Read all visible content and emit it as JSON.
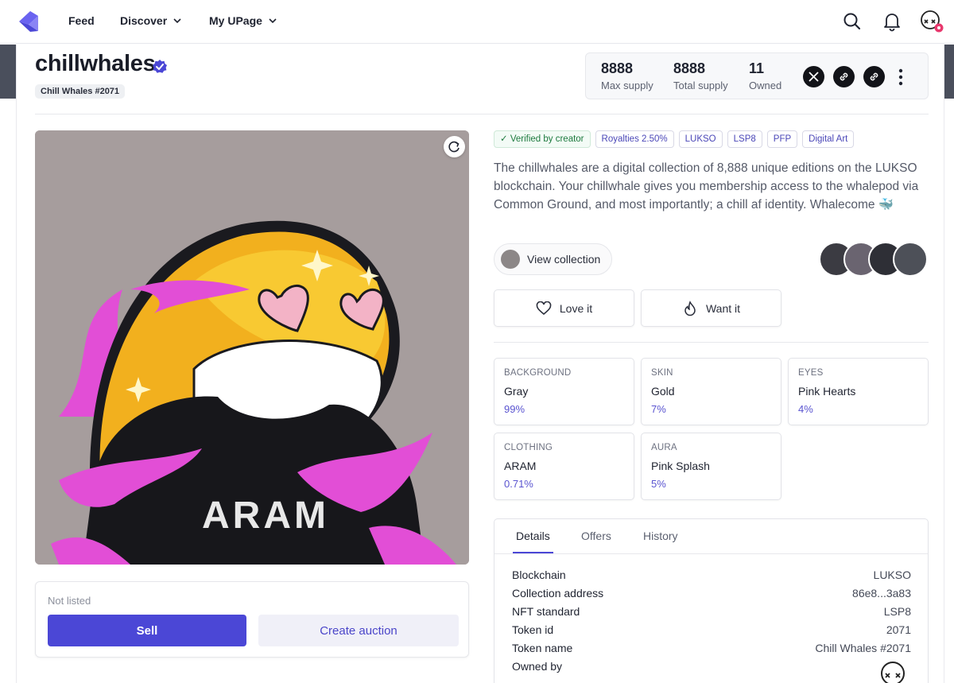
{
  "nav": {
    "feed": "Feed",
    "discover": "Discover",
    "my_upage": "My UPage",
    "icons": [
      "search-icon",
      "bell-icon",
      "profile-avatar"
    ]
  },
  "header": {
    "title": "chillwhales",
    "token_label": "Chill Whales #2071",
    "stats": [
      {
        "value": "8888",
        "label": "Max supply"
      },
      {
        "value": "8888",
        "label": "Total supply"
      },
      {
        "value": "11",
        "label": "Owned"
      }
    ],
    "social_icons": [
      "x-icon",
      "link-icon",
      "link-icon",
      "more-vertical-icon"
    ]
  },
  "sale": {
    "status": "Not listed",
    "sell_label": "Sell",
    "auction_label": "Create auction"
  },
  "tags": [
    "✓ Verified by creator",
    "Royalties 2.50%",
    "LUKSO",
    "LSP8",
    "PFP",
    "Digital Art"
  ],
  "description": "The chillwhales are a digital collection of 8,888 unique editions on the LUKSO blockchain. Your chillwhale gives you membership access to the whalepod via Common Ground, and most importantly; a chill af identity. Whalecome 🐳",
  "collection": {
    "button_label": "View collection"
  },
  "actions": {
    "love": "Love it",
    "want": "Want it"
  },
  "traits": [
    {
      "key": "BACKGROUND",
      "value": "Gray",
      "pct": "99%"
    },
    {
      "key": "SKIN",
      "value": "Gold",
      "pct": "7%"
    },
    {
      "key": "EYES",
      "value": "Pink Hearts",
      "pct": "4%"
    },
    {
      "key": "CLOTHING",
      "value": "ARAM",
      "pct": "0.71%"
    },
    {
      "key": "AURA",
      "value": "Pink Splash",
      "pct": "5%"
    }
  ],
  "details": {
    "tabs": [
      "Details",
      "Offers",
      "History"
    ],
    "active_tab": "Details",
    "rows": [
      {
        "key": "Blockchain",
        "value": "LUKSO"
      },
      {
        "key": "Collection address",
        "value": "86e8...3a83"
      },
      {
        "key": "NFT standard",
        "value": "LSP8"
      },
      {
        "key": "Token id",
        "value": "2071"
      },
      {
        "key": "Token name",
        "value": "Chill Whales #2071"
      },
      {
        "key": "Owned by",
        "value": ""
      }
    ]
  },
  "artwork": {
    "hoodie_text": "ARAM"
  },
  "colors": {
    "accent": "#4b47d6",
    "verified": "#4b47d6",
    "background": "#a69d9d"
  }
}
